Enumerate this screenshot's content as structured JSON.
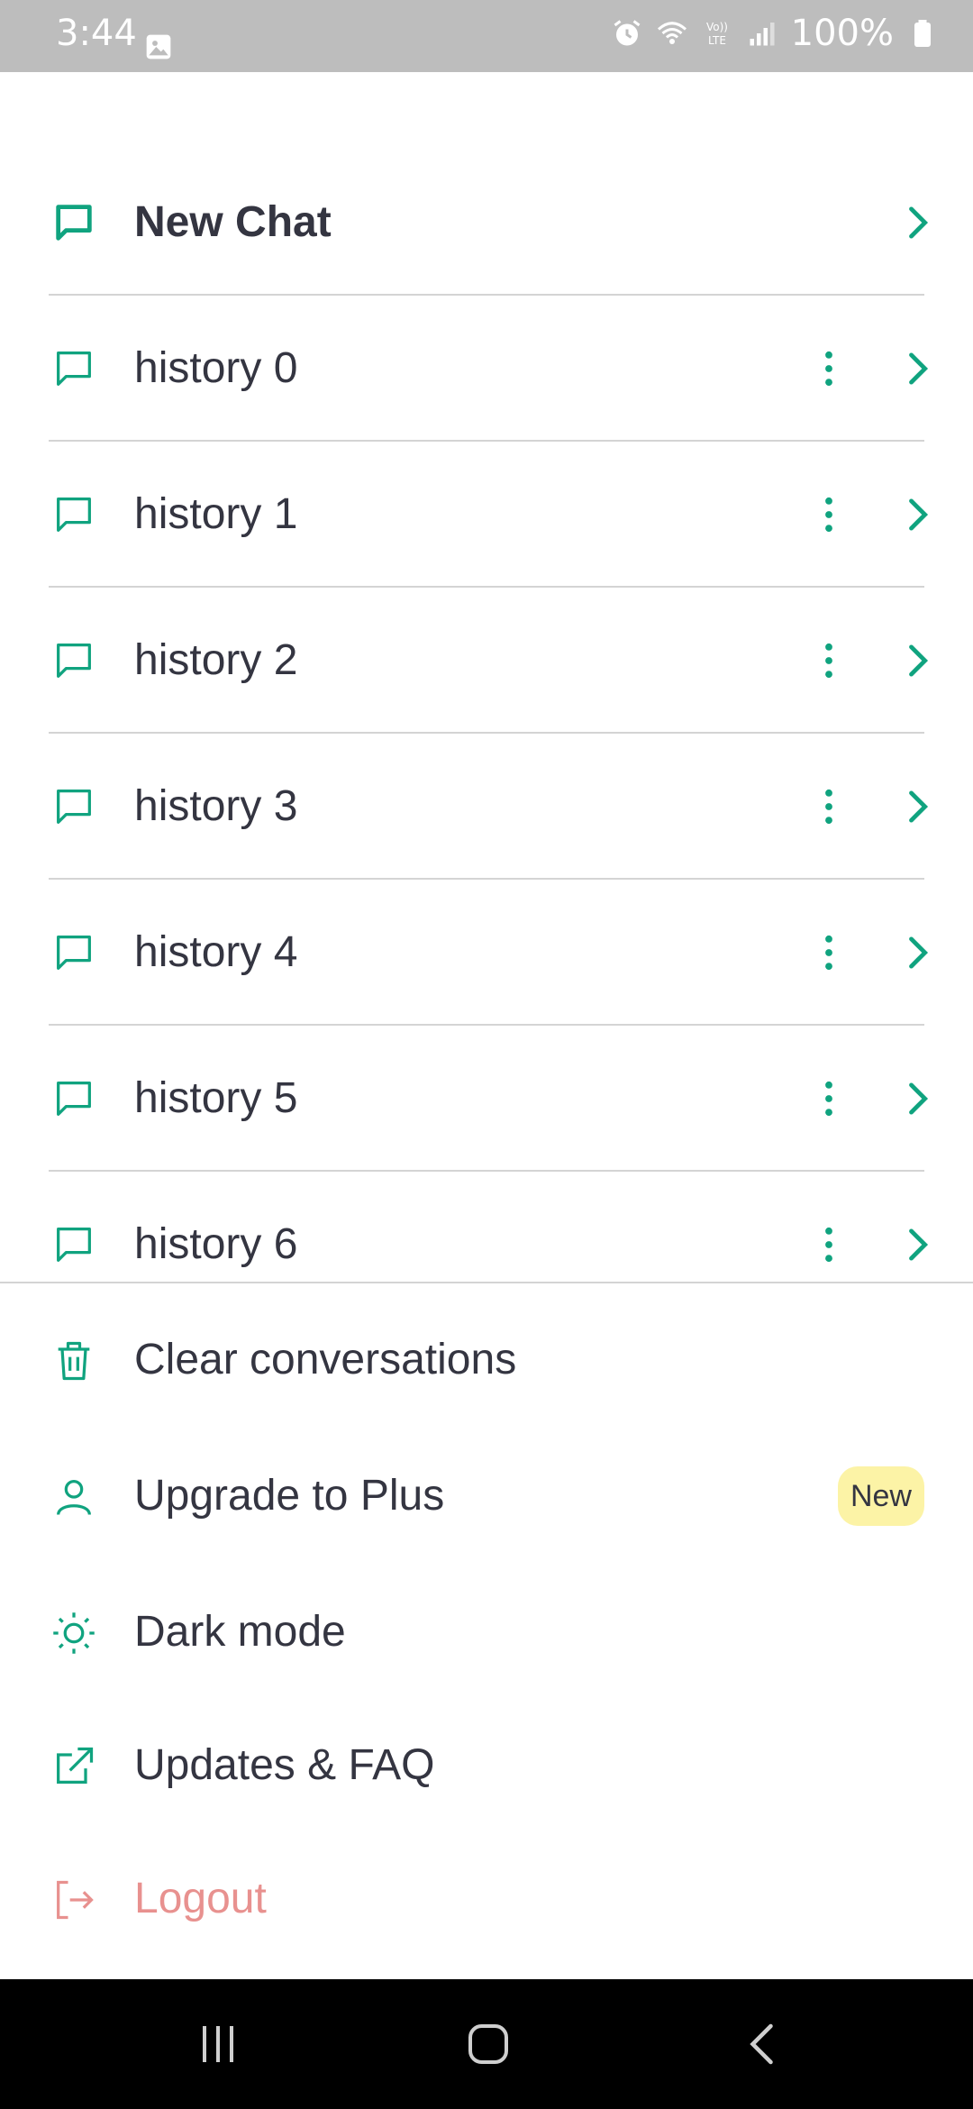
{
  "status_bar": {
    "time": "3:44",
    "battery": "100%",
    "icons": [
      "gallery-icon",
      "alarm-icon",
      "wifi-icon",
      "volte-icon",
      "signal-icon",
      "battery-icon"
    ]
  },
  "colors": {
    "accent": "#10a37f",
    "text": "#343541",
    "divider": "#d4d4d4",
    "logout": "#e8918f",
    "badge_bg": "#fcf3a6",
    "status_bar_bg": "#bdbdbd"
  },
  "new_chat": {
    "label": "New Chat",
    "icon": "chat-bubble-icon"
  },
  "history": [
    {
      "label": "history 0"
    },
    {
      "label": "history 1"
    },
    {
      "label": "history 2"
    },
    {
      "label": "history 3"
    },
    {
      "label": "history 4"
    },
    {
      "label": "history 5"
    },
    {
      "label": "history 6"
    }
  ],
  "menu": {
    "clear": {
      "label": "Clear conversations",
      "icon": "trash-icon"
    },
    "upgrade": {
      "label": "Upgrade to Plus",
      "icon": "user-icon",
      "badge": "New"
    },
    "dark_mode": {
      "label": "Dark mode",
      "icon": "sun-icon"
    },
    "updates": {
      "label": "Updates & FAQ",
      "icon": "external-link-icon"
    },
    "logout": {
      "label": "Logout",
      "icon": "logout-icon"
    }
  },
  "nav_bar": {
    "icons": [
      "recent-apps-icon",
      "home-icon",
      "back-icon"
    ]
  }
}
